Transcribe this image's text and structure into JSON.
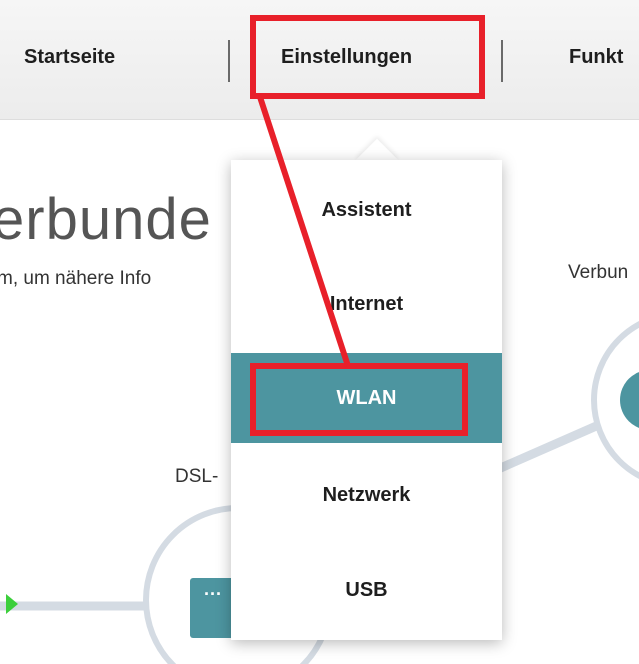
{
  "nav": {
    "items": [
      {
        "label": "Startseite"
      },
      {
        "label": "Einstellungen"
      },
      {
        "label": "Funkt"
      }
    ]
  },
  "page": {
    "heading": "erbunde",
    "hint": "m, um nähere Info",
    "right_label": "Verbun",
    "dsl_label": "DSL-"
  },
  "dropdown": {
    "items": [
      {
        "label": "Assistent"
      },
      {
        "label": "Internet"
      },
      {
        "label": "WLAN",
        "active": true
      },
      {
        "label": "Netzwerk"
      },
      {
        "label": "USB"
      }
    ]
  },
  "colors": {
    "active_item": "#4d95a0",
    "annotation": "#e8202a",
    "node_accent": "#4d95a0",
    "status_green": "#3ccf3c"
  }
}
